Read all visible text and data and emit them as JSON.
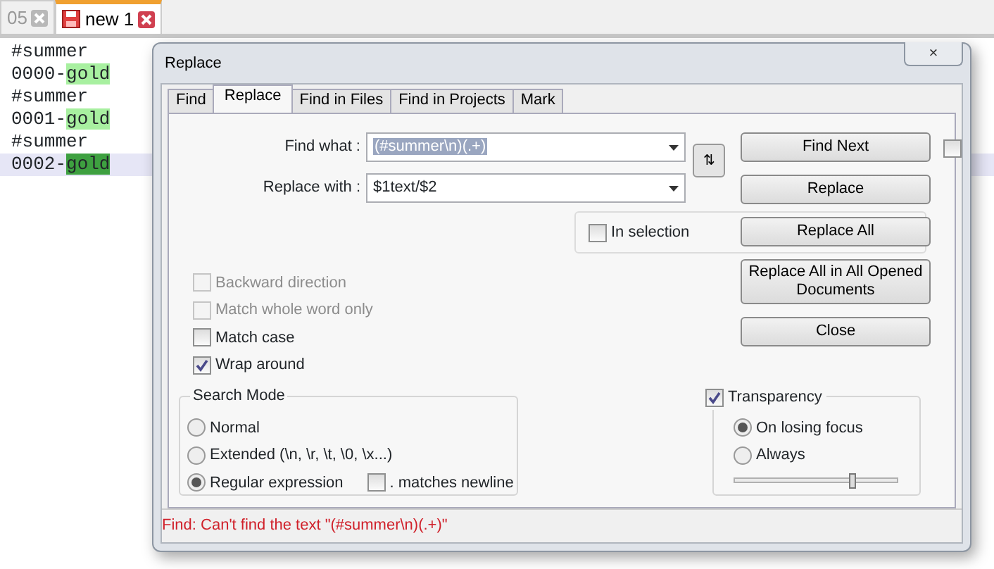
{
  "editor_tabs": [
    {
      "label": "05",
      "selected": false,
      "saved": true
    },
    {
      "label": "new 1",
      "selected": true,
      "saved": false
    }
  ],
  "editor_lines": [
    {
      "prefix": "#summer",
      "current": false
    },
    {
      "prefix": "0000-",
      "match": "gold",
      "current_match": false,
      "current": false
    },
    {
      "prefix": "#summer",
      "current": false
    },
    {
      "prefix": "0001-",
      "match": "gold",
      "current_match": false,
      "current": false
    },
    {
      "prefix": "#summer",
      "current": false
    },
    {
      "prefix": "0002-",
      "match": "gold",
      "current_match": true,
      "current": true
    }
  ],
  "dialog": {
    "title": "Replace",
    "close": "×",
    "tabs": [
      {
        "label": "Find",
        "selected": false
      },
      {
        "label": "Replace",
        "selected": true
      },
      {
        "label": "Find in Files",
        "selected": false
      },
      {
        "label": "Find in Projects",
        "selected": false
      },
      {
        "label": "Mark",
        "selected": false
      }
    ],
    "fields": [
      {
        "label": "Find what :",
        "value": "(#summer\\n)(.+)",
        "highlighted": true
      },
      {
        "label": "Replace with :",
        "value": "$1text/$2",
        "highlighted": false
      }
    ],
    "swap_button": "⇅",
    "buttons": [
      "Find Next",
      "Replace",
      "Replace All",
      "Replace All in All Opened Documents",
      "Close"
    ],
    "stay_on_top": {
      "checked": false
    },
    "in_selection": {
      "label": "In selection",
      "checked": false
    },
    "options": [
      {
        "label": "Backward direction",
        "checked": false,
        "disabled": true
      },
      {
        "label": "Match whole word only",
        "checked": false,
        "disabled": true
      },
      {
        "label": "Match case",
        "checked": false,
        "disabled": false
      },
      {
        "label": "Wrap around",
        "checked": true,
        "disabled": false
      }
    ],
    "search_mode": {
      "title": "Search Mode",
      "modes": [
        {
          "label": "Normal",
          "selected": false
        },
        {
          "label": "Extended (\\n, \\r, \\t, \\0, \\x...)",
          "selected": false
        },
        {
          "label": "Regular expression",
          "selected": true
        }
      ],
      "dot_newline": {
        "label": ". matches newline",
        "checked": false
      }
    },
    "transparency": {
      "label": "Transparency",
      "checked": true,
      "modes": [
        {
          "label": "On losing focus",
          "selected": true
        },
        {
          "label": "Always",
          "selected": false
        }
      ],
      "level": 0.72
    },
    "status": "Find: Can't find the text \"(#summer\\n)(.+)\""
  }
}
